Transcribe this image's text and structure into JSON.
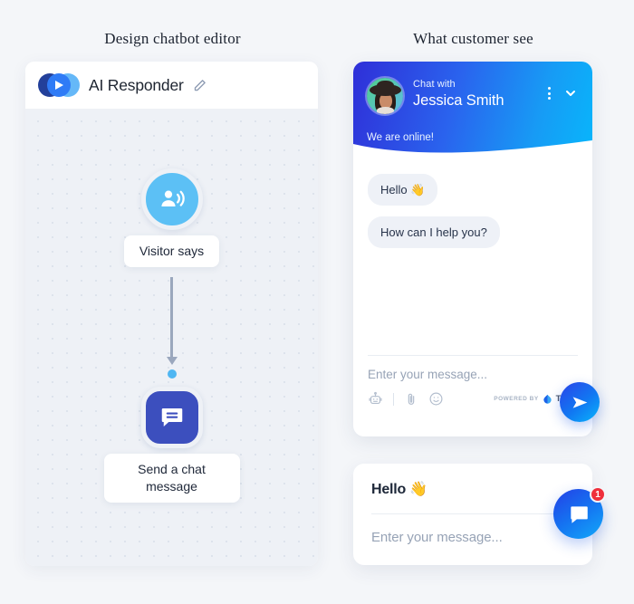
{
  "headings": {
    "left": "Design chatbot editor",
    "right": "What customer see"
  },
  "editor": {
    "title": "AI Responder",
    "logo_icon": "tidio-play-logo-icon",
    "edit_icon": "pencil-icon",
    "nodes": [
      {
        "label": "Visitor says",
        "icon": "person-speaking-icon",
        "shape": "circle",
        "color": "#5cc0f5"
      },
      {
        "label": "Send a chat message",
        "icon": "chat-message-icon",
        "shape": "rounded-square",
        "color": "#3c4fbe"
      }
    ],
    "connector": {
      "arrow_color": "#9aa7bd",
      "dot_color": "#4fb6f2"
    }
  },
  "widget": {
    "header": {
      "chat_with_label": "Chat with",
      "agent_name": "Jessica Smith",
      "status": "We are online!",
      "menu_icon": "kebab-menu-icon",
      "collapse_icon": "chevron-down-icon",
      "avatar_icon": "agent-avatar",
      "gradient_from": "#2f2fd8",
      "gradient_to": "#08b6fb"
    },
    "messages": [
      {
        "text": "Hello 👋",
        "from": "bot"
      },
      {
        "text": "How can I help you?",
        "from": "bot"
      }
    ],
    "input": {
      "placeholder": "Enter your message...",
      "value": ""
    },
    "footer": {
      "bot_icon": "robot-icon",
      "attach_icon": "paperclip-icon",
      "emoji_icon": "emoji-smiley-icon",
      "powered_by": "POWERED BY",
      "brand": "TIDIO",
      "brand_icon": "tidio-drop-icon"
    },
    "send_button": {
      "icon": "send-paper-plane-icon"
    }
  },
  "mini_card": {
    "greeting": "Hello 👋",
    "input_placeholder": "Enter your message...",
    "launcher": {
      "icon": "chat-bubble-icon",
      "badge_count": "1",
      "badge_color": "#ef2f3c"
    }
  }
}
